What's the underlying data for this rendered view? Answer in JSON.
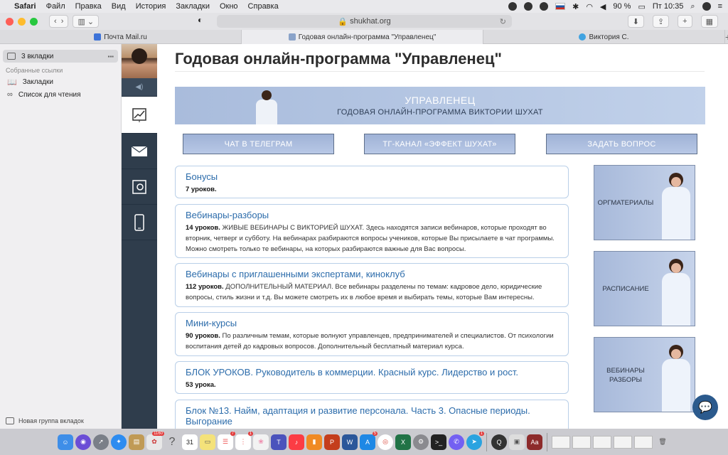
{
  "menubar": {
    "app_name": "Safari",
    "items": [
      "Файл",
      "Правка",
      "Вид",
      "История",
      "Закладки",
      "Окно",
      "Справка"
    ],
    "battery": "90 %",
    "clock": "Пт 10:35"
  },
  "toolbar": {
    "url": "shukhat.org"
  },
  "tabs": [
    {
      "label": "Почта Mail.ru",
      "icon": "mail-icon"
    },
    {
      "label": "Годовая онлайн-программа \"Управленец\"",
      "icon": "site-icon"
    },
    {
      "label": "Виктория С.",
      "icon": "telegram-icon"
    }
  ],
  "sidebar": {
    "tabs_label": "3 вкладки",
    "collected_header": "Собранные ссылки",
    "items": [
      {
        "label": "Закладки",
        "icon": "book-icon"
      },
      {
        "label": "Список для чтения",
        "icon": "glasses-icon"
      }
    ],
    "new_group": "Новая группа вкладок"
  },
  "page": {
    "title": "Годовая онлайн-программа \"Управленец\"",
    "banner_title": "УПРАВЛЕНЕЦ",
    "banner_subtitle": "ГОДОВАЯ ОНЛАЙН-ПРОГРАММА ВИКТОРИИ ШУХАТ",
    "buttons": [
      "ЧАТ В ТЕЛЕГРАМ",
      "ТГ-КАНАЛ «ЭФФЕКТ ШУХАТ»",
      "ЗАДАТЬ ВОПРОС"
    ],
    "cards": [
      {
        "title": "Бонусы",
        "count": "7 уроков.",
        "desc": ""
      },
      {
        "title": "Вебинары-разборы",
        "count": "14 уроков.",
        "desc": " ЖИВЫЕ ВЕБИНАРЫ С ВИКТОРИЕЙ ШУХАТ. Здесь находятся записи вебинаров, которые проходят во вторник, четверг и субботу. На вебинарах разбираются вопросы учеников, которые Вы присылаете в чат программы. Можно смотреть только те вебинары, на которых разбираются важные для Вас вопросы."
      },
      {
        "title": "Вебинары с приглашенными экспертами, киноклуб",
        "count": "112 уроков.",
        "desc": " ДОПОЛНИТЕЛЬНЫЙ МАТЕРИАЛ. Все вебинары разделены по темам: кадровое дело, юридические вопросы, стиль жизни и т.д. Вы можете смотреть их в любое время и выбирать темы, которые Вам интересны."
      },
      {
        "title": "Мини-курсы",
        "count": "90 уроков.",
        "desc": " По различным темам, которые волнуют управленцев, предпринимателей и специалистов. От психологии воспитания детей до кадровых вопросов. Дополнительный бесплатный материал курса."
      },
      {
        "title": "БЛОК УРОКОВ. Руководитель в коммерции. Красный курс. Лидерство и рост.",
        "count": "53 урока.",
        "desc": ""
      },
      {
        "title": "Блок №13. Найм, адаптация и развитие персонала. Часть 3. Опасные периоды. Выгорание",
        "count": "",
        "desc": ""
      }
    ],
    "side_tiles": [
      "ОРГМАТЕРИАЛЫ",
      "РАСПИСАНИЕ",
      "ВЕБИНАРЫ РАЗБОРЫ"
    ]
  },
  "dock": {
    "badges": {
      "photos_badge": "1160",
      "app7": "7",
      "app1a": "1",
      "app5": "5",
      "app1b": "1"
    },
    "calendar_day": "31",
    "apps": [
      "finder",
      "siri",
      "launchpad",
      "safari",
      "notes",
      "photos",
      "help",
      "calendar",
      "stickies",
      "reminders",
      "mindmap",
      "photos2",
      "teams",
      "music",
      "books",
      "powerpoint",
      "word",
      "appstore",
      "chrome",
      "excel",
      "settings",
      "terminal",
      "viber",
      "telegram",
      "quicktime",
      "preview",
      "dictionary"
    ]
  }
}
